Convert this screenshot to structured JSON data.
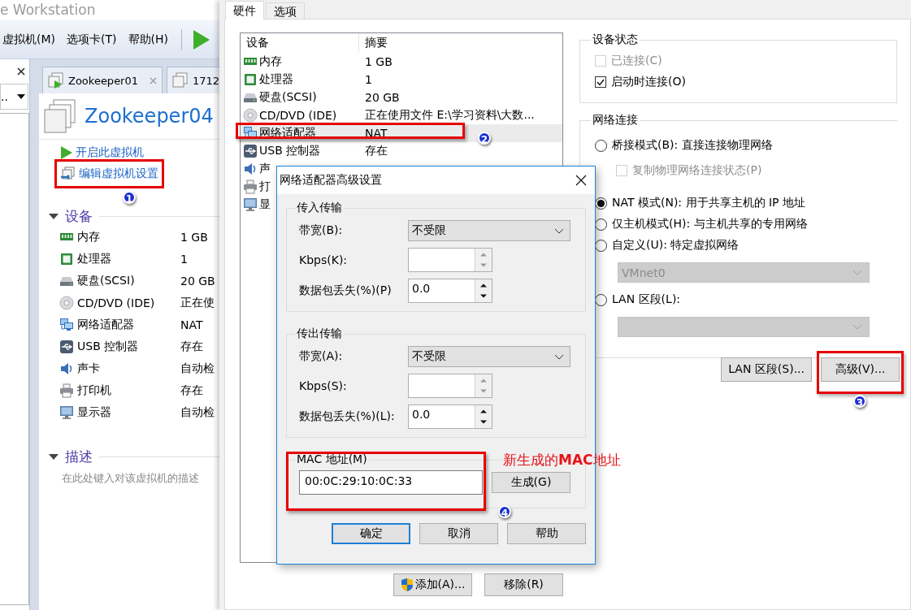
{
  "main_window": {
    "title": "e Workstation",
    "menu": [
      "虚拟机(M)",
      "选项卡(T)",
      "帮助(H)"
    ],
    "library_filter": "..",
    "tabs": [
      {
        "label": "Zookeeper01",
        "selected": false,
        "running": true,
        "closable": true
      },
      {
        "label": "1712",
        "selected": false,
        "running": false,
        "closable": false
      }
    ],
    "vm_name": "Zookeeper04",
    "actions": [
      {
        "label": "开启此虚拟机",
        "kind": "power_on",
        "highlighted": false
      },
      {
        "label": "编辑虚拟机设置",
        "kind": "edit",
        "highlighted": true,
        "badge": "1"
      }
    ],
    "devices_heading": "设备",
    "devices": [
      {
        "name": "内存",
        "value": "1 GB",
        "kind": "memory"
      },
      {
        "name": "处理器",
        "value": "1",
        "kind": "cpu"
      },
      {
        "name": "硬盘(SCSI)",
        "value": "20 GB",
        "kind": "disk"
      },
      {
        "name": "CD/DVD (IDE)",
        "value": "正在使",
        "kind": "cd"
      },
      {
        "name": "网络适配器",
        "value": "NAT",
        "kind": "network"
      },
      {
        "name": "USB 控制器",
        "value": "存在",
        "kind": "usb"
      },
      {
        "name": "声卡",
        "value": "自动检",
        "kind": "sound"
      },
      {
        "name": "打印机",
        "value": "存在",
        "kind": "printer"
      },
      {
        "name": "显示器",
        "value": "自动检",
        "kind": "display"
      }
    ],
    "description_heading": "描述",
    "description_placeholder": "在此处键入对该虚拟机的描述"
  },
  "settings": {
    "tabs": [
      {
        "label": "硬件",
        "selected": true
      },
      {
        "label": "选项",
        "selected": false
      }
    ],
    "columns": [
      "设备",
      "摘要"
    ],
    "devices": [
      {
        "name": "内存",
        "summary": "1 GB",
        "kind": "memory",
        "selected": false,
        "highlighted": false
      },
      {
        "name": "处理器",
        "summary": "1",
        "kind": "cpu",
        "selected": false,
        "highlighted": false
      },
      {
        "name": "硬盘(SCSI)",
        "summary": "20 GB",
        "kind": "disk",
        "selected": false,
        "highlighted": false
      },
      {
        "name": "CD/DVD (IDE)",
        "summary": "正在使用文件 E:\\学习资料\\大数...",
        "kind": "cd",
        "selected": false,
        "highlighted": false
      },
      {
        "name": "网络适配器",
        "summary": "NAT",
        "kind": "network",
        "selected": true,
        "highlighted": true,
        "badge": "2"
      },
      {
        "name": "USB 控制器",
        "summary": "存在",
        "kind": "usb",
        "selected": false,
        "highlighted": false
      },
      {
        "name": "声",
        "kind": "sound",
        "selected": false,
        "highlighted": false
      },
      {
        "name": "打",
        "kind": "printer",
        "selected": false,
        "highlighted": false
      },
      {
        "name": "显",
        "kind": "display",
        "selected": false,
        "highlighted": false
      }
    ],
    "list_buttons": [
      {
        "label": "添加(A)...",
        "kind": "shield"
      },
      {
        "label": "移除(R)",
        "kind": "plain"
      }
    ],
    "device_status": {
      "title": "设备状态",
      "options": [
        {
          "label": "已连接(C)",
          "checked": false,
          "disabled": true
        },
        {
          "label": "启动时连接(O)",
          "checked": true,
          "disabled": false
        }
      ]
    },
    "network_connection": {
      "title": "网络连接",
      "options": [
        {
          "kind": "radio",
          "label": "桥接模式(B): 直接连接物理网络",
          "selected": false
        },
        {
          "kind": "checkbox",
          "label": "复制物理网络连接状态(P)",
          "checked": false,
          "disabled": true
        },
        {
          "kind": "radio",
          "label": "NAT 模式(N): 用于共享主机的 IP 地址",
          "selected": true
        },
        {
          "kind": "radio",
          "label": "仅主机模式(H): 与主机共享的专用网络",
          "selected": false
        },
        {
          "kind": "radio",
          "label": "自定义(U): 特定虚拟网络",
          "selected": false
        },
        {
          "kind": "select",
          "value": "VMnet0",
          "disabled": true
        },
        {
          "kind": "radio",
          "label": "LAN 区段(L):",
          "selected": false
        },
        {
          "kind": "select",
          "disabled": true
        }
      ]
    },
    "buttons": [
      {
        "label": "LAN 区段(S)...",
        "highlighted": false
      },
      {
        "label": "高级(V)...",
        "highlighted": true,
        "badge": "3"
      }
    ]
  },
  "dialog": {
    "title": "网络适配器高级设置",
    "groups": [
      {
        "title": "传入传输",
        "bandwidth_label": "带宽(B):",
        "bandwidth": "不受限",
        "kbps_label": "Kbps(K):",
        "loss_label": "数据包丢失(%)(P)",
        "loss": "0.0"
      },
      {
        "title": "传出传输",
        "bandwidth_label": "带宽(A):",
        "bandwidth": "不受限",
        "kbps_label": "Kbps(S):",
        "loss_label": "数据包丢失(%)(L):",
        "loss": "0.0"
      }
    ],
    "mac": {
      "title": "MAC 地址(M)",
      "value": "00:0C:29:10:0C:33",
      "button": "生成(G)",
      "highlighted": true,
      "badge": "4",
      "note": "新生成的**MAC**地址"
    },
    "buttons": [
      {
        "label": "确定",
        "default": true
      },
      {
        "label": "取消",
        "default": false
      },
      {
        "label": "帮助",
        "default": false
      }
    ]
  }
}
